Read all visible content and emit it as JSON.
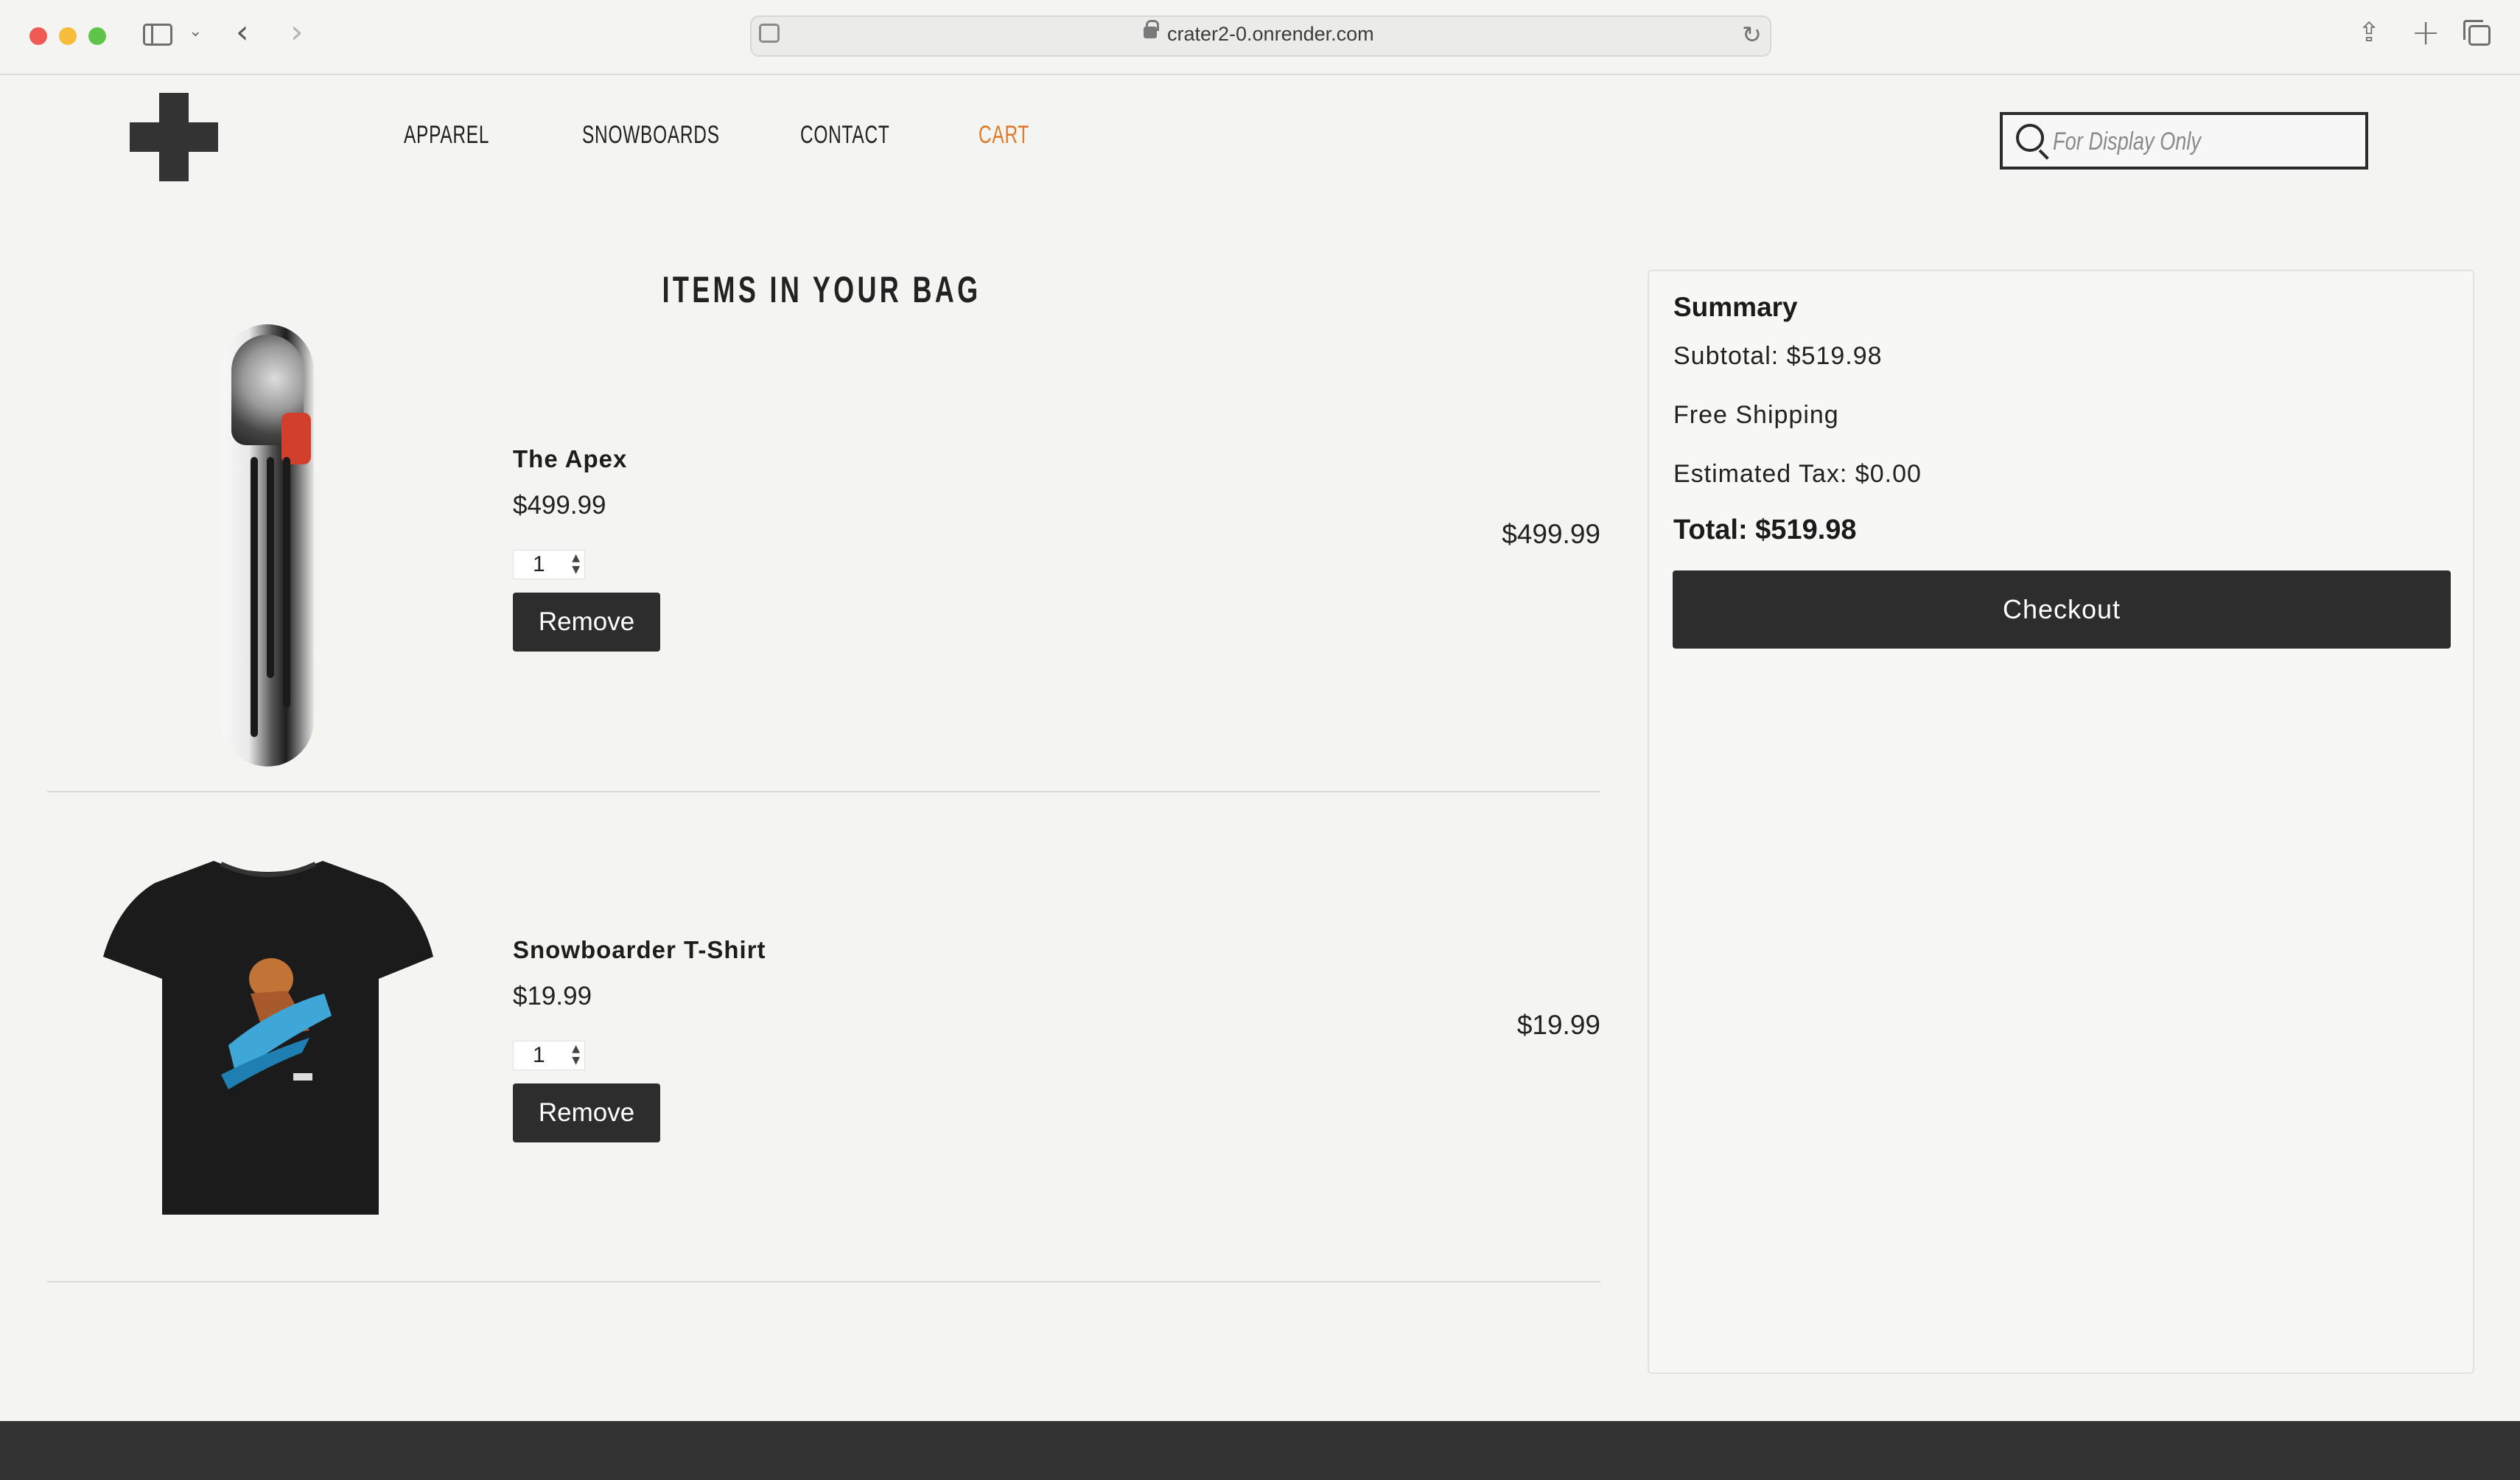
{
  "browser": {
    "url": "crater2-0.onrender.com"
  },
  "nav": {
    "links": [
      "APPAREL",
      "SNOWBOARDS",
      "CONTACT",
      "CART"
    ],
    "active": "CART",
    "active_color": "#e07a26"
  },
  "search": {
    "placeholder": "For Display Only"
  },
  "cart": {
    "title": "ITEMS IN YOUR BAG",
    "items": [
      {
        "name": "The Apex",
        "price": "$499.99",
        "quantity": "1",
        "remove_label": "Remove",
        "line_total": "$499.99",
        "image": "snowboard-image"
      },
      {
        "name": "Snowboarder T-Shirt",
        "price": "$19.99",
        "quantity": "1",
        "remove_label": "Remove",
        "line_total": "$19.99",
        "image": "tshirt-image"
      }
    ]
  },
  "summary": {
    "title": "Summary",
    "subtotal": "Subtotal: $519.98",
    "shipping": "Free Shipping",
    "tax": "Estimated Tax: $0.00",
    "total": "Total: $519.98",
    "checkout_label": "Checkout"
  },
  "colors": {
    "button_bg": "#2d2d2d",
    "accent": "#e07a26"
  }
}
